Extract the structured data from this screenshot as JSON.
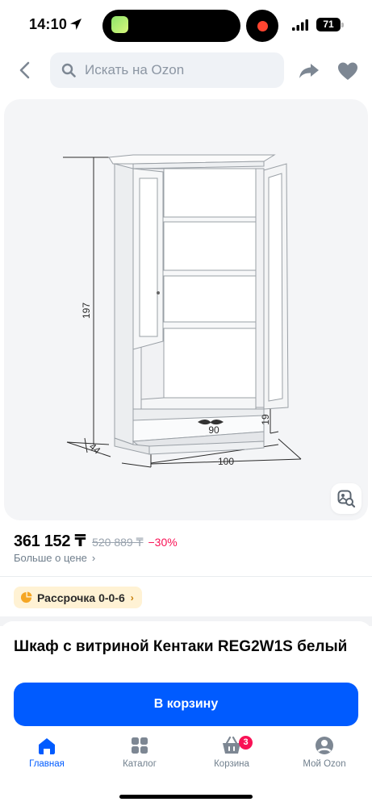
{
  "status_bar": {
    "time": "14:10",
    "battery": "71"
  },
  "search": {
    "placeholder": "Искать на Ozon"
  },
  "product_image": {
    "dimension_height": "197",
    "dimension_depth": "44",
    "dimension_width": "100",
    "dimension_inner_width": "90",
    "dimension_plinth": "19"
  },
  "price": {
    "current": "361 152 ₸",
    "old": "520 889 ₸",
    "discount": "−30%",
    "more_label": "Больше о цене",
    "more_chevron": "›"
  },
  "installment": {
    "label": "Рассрочка 0-0-6",
    "chevron": "›"
  },
  "product": {
    "title": "Шкаф с витриной Кентаки REG2W1S белый"
  },
  "actions": {
    "add_to_cart": "В корзину"
  },
  "tabs": [
    {
      "label": "Главная",
      "icon": "home-icon",
      "active": true
    },
    {
      "label": "Каталог",
      "icon": "catalog-icon"
    },
    {
      "label": "Корзина",
      "icon": "cart-icon",
      "badge": "3"
    },
    {
      "label": "Мой Ozon",
      "icon": "profile-icon"
    }
  ],
  "colors": {
    "accent": "#005bff",
    "discount": "#f91155",
    "installment_bg": "#fff2d4"
  }
}
